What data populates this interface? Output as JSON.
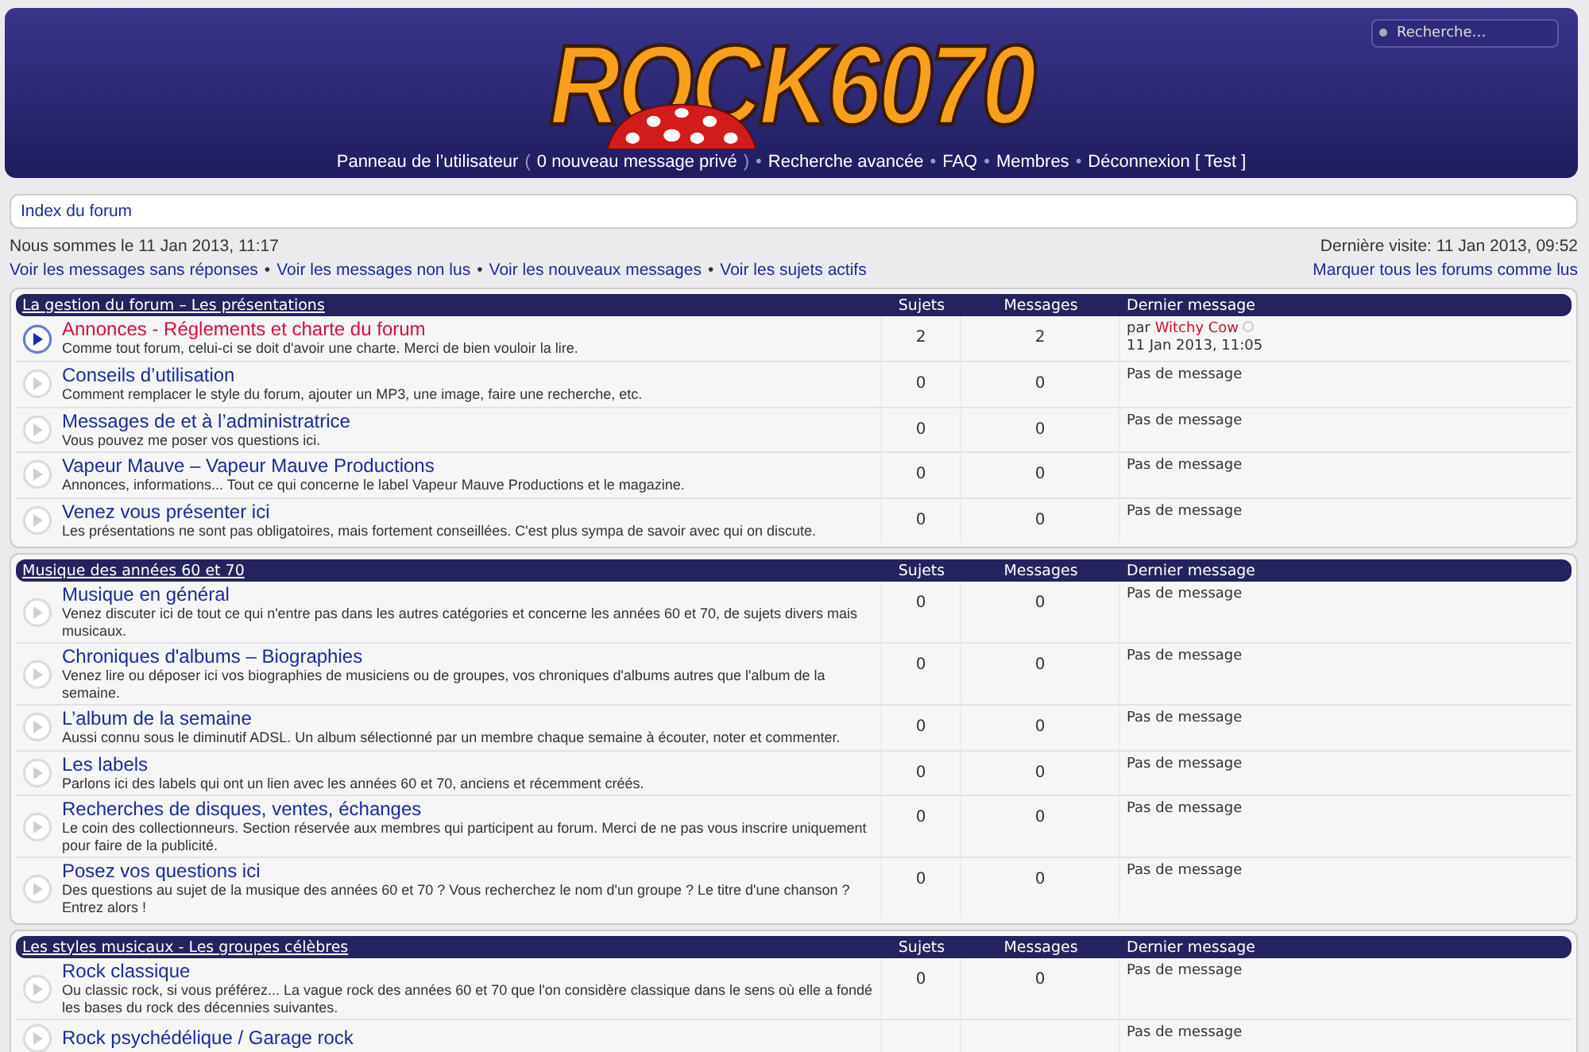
{
  "header": {
    "logo": "ROCK6070",
    "search": {
      "placeholder": "Recherche…"
    },
    "nav": [
      {
        "text": "Panneau de l’utilisateur",
        "kind": "link"
      },
      {
        "text": "(",
        "kind": "punct"
      },
      {
        "text": "0 nouveau message privé",
        "kind": "link"
      },
      {
        "text": ")",
        "kind": "punct"
      },
      {
        "text": "•",
        "kind": "punct"
      },
      {
        "text": "Recherche avancée",
        "kind": "link"
      },
      {
        "text": "•",
        "kind": "punct"
      },
      {
        "text": "FAQ",
        "kind": "link"
      },
      {
        "text": "•",
        "kind": "punct"
      },
      {
        "text": "Membres",
        "kind": "link"
      },
      {
        "text": "•",
        "kind": "punct"
      },
      {
        "text": "Déconnexion [ Test ]",
        "kind": "link"
      }
    ]
  },
  "breadcrumb": "Index du forum",
  "current_time": "Nous sommes le 11 Jan 2013, 11:17",
  "last_visit": "Dernière visite: 11 Jan 2013, 09:52",
  "quick_links": [
    {
      "text": "Voir les messages sans réponses",
      "kind": "link"
    },
    {
      "text": "•",
      "kind": "punct"
    },
    {
      "text": "Voir les messages non lus",
      "kind": "link"
    },
    {
      "text": "•",
      "kind": "punct"
    },
    {
      "text": "Voir les nouveaux messages",
      "kind": "link"
    },
    {
      "text": "•",
      "kind": "punct"
    },
    {
      "text": "Voir les sujets actifs",
      "kind": "link"
    }
  ],
  "mark_all_read": "Marquer tous les forums comme lus",
  "categories": [
    {
      "title": "La gestion du forum – Les présentations",
      "columns": [
        "Sujets",
        "Messages",
        "Dernier message"
      ],
      "forums": [
        {
          "title": "Annonces - Réglements et charte du forum",
          "description": "Comme tout forum, celui-ci se doit d'avoir une charte. Merci de bien vouloir la lire.",
          "unread": true,
          "topics": "2",
          "posts": "2",
          "last_post": {
            "kind": "post",
            "prefix": "par",
            "author": "Witchy Cow",
            "date": "11 Jan 2013, 11:05"
          }
        },
        {
          "title": "Conseils d’utilisation",
          "description": "Comment remplacer le style du forum, ajouter un MP3, une image, faire une recherche, etc.",
          "unread": false,
          "topics": "0",
          "posts": "0",
          "last_post": {
            "kind": "none",
            "text": "Pas de message"
          }
        },
        {
          "title": "Messages de et à l’administratrice",
          "description": "Vous pouvez me poser vos questions ici.",
          "unread": false,
          "topics": "0",
          "posts": "0",
          "last_post": {
            "kind": "none",
            "text": "Pas de message"
          }
        },
        {
          "title": "Vapeur Mauve – Vapeur Mauve Productions",
          "description": "Annonces, informations... Tout ce qui concerne le label Vapeur Mauve Productions et le magazine.",
          "unread": false,
          "topics": "0",
          "posts": "0",
          "last_post": {
            "kind": "none",
            "text": "Pas de message"
          }
        },
        {
          "title": "Venez vous présenter ici",
          "description": "Les présentations ne sont pas obligatoires, mais fortement conseillées. C'est plus sympa de savoir avec qui on discute.",
          "unread": false,
          "topics": "0",
          "posts": "0",
          "last_post": {
            "kind": "none",
            "text": "Pas de message"
          }
        }
      ]
    },
    {
      "title": "Musique des années 60 et 70",
      "columns": [
        "Sujets",
        "Messages",
        "Dernier message"
      ],
      "forums": [
        {
          "title": "Musique en général",
          "description": "Venez discuter ici de tout ce qui n'entre pas dans les autres catégories et concerne les années 60 et 70, de sujets divers mais musicaux.",
          "unread": false,
          "topics": "0",
          "posts": "0",
          "last_post": {
            "kind": "none",
            "text": "Pas de message"
          }
        },
        {
          "title": "Chroniques d'albums – Biographies",
          "description": "Venez lire ou déposer ici vos biographies de musiciens ou de groupes, vos chroniques d'albums autres que l'album de la semaine.",
          "unread": false,
          "topics": "0",
          "posts": "0",
          "last_post": {
            "kind": "none",
            "text": "Pas de message"
          }
        },
        {
          "title": "L’album de la semaine",
          "description": "Aussi connu sous le diminutif ADSL. Un album sélectionné par un membre chaque semaine à écouter, noter et commenter.",
          "unread": false,
          "topics": "0",
          "posts": "0",
          "last_post": {
            "kind": "none",
            "text": "Pas de message"
          }
        },
        {
          "title": "Les labels",
          "description": "Parlons ici des labels qui ont un lien avec les années 60 et 70, anciens et récemment créés.",
          "unread": false,
          "topics": "0",
          "posts": "0",
          "last_post": {
            "kind": "none",
            "text": "Pas de message"
          }
        },
        {
          "title": "Recherches de disques, ventes, échanges",
          "description": "Le coin des collectionneurs. Section réservée aux membres qui participent au forum. Merci de ne pas vous inscrire uniquement pour faire de la publicité.",
          "unread": false,
          "topics": "0",
          "posts": "0",
          "last_post": {
            "kind": "none",
            "text": "Pas de message"
          }
        },
        {
          "title": "Posez vos questions ici",
          "description": "Des questions au sujet de la musique des années 60 et 70 ? Vous recherchez le nom d'un groupe ? Le titre d'une chanson ? Entrez alors !",
          "unread": false,
          "topics": "0",
          "posts": "0",
          "last_post": {
            "kind": "none",
            "text": "Pas de message"
          }
        }
      ]
    },
    {
      "title": "Les styles musicaux - Les groupes célèbres",
      "columns": [
        "Sujets",
        "Messages",
        "Dernier message"
      ],
      "forums": [
        {
          "title": "Rock classique",
          "description": "Ou classic rock, si vous préférez... La vague rock des années 60 et 70 que l'on considère classique dans le sens où elle a fondé les bases du rock des décennies suivantes.",
          "unread": false,
          "topics": "0",
          "posts": "0",
          "last_post": {
            "kind": "none",
            "text": "Pas de message"
          }
        },
        {
          "title": "Rock psychédélique / Garage rock",
          "unread": false,
          "last_post": {
            "kind": "none",
            "text": "Pas de message"
          }
        }
      ]
    }
  ]
}
